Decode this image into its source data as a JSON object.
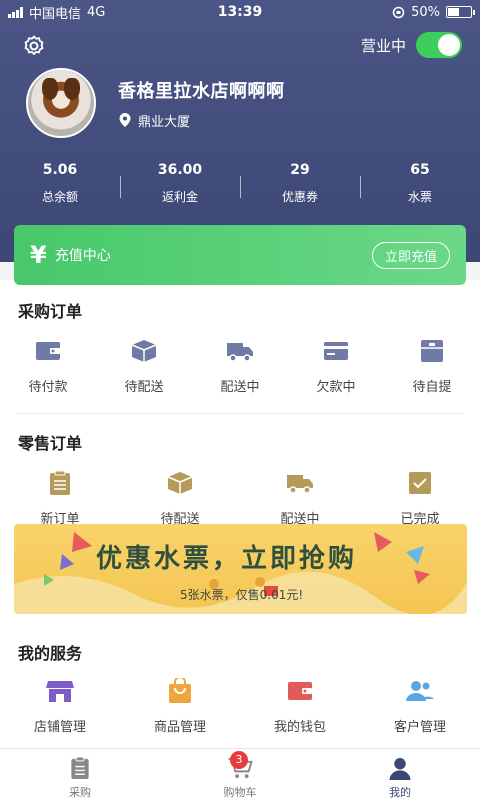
{
  "status_bar": {
    "carrier": "中国电信",
    "network": "4G",
    "time": "13:39",
    "battery": "50%",
    "battery_level": 0.5
  },
  "header": {
    "open_label": "营业中",
    "open_state": true
  },
  "shop": {
    "name": "香格里拉水店啊啊啊",
    "location": "鼎业大厦"
  },
  "stats": [
    {
      "value": "5.06",
      "label": "总余额"
    },
    {
      "value": "36.00",
      "label": "返利金"
    },
    {
      "value": "29",
      "label": "优惠券"
    },
    {
      "value": "65",
      "label": "水票"
    }
  ],
  "recharge": {
    "symbol": "¥",
    "title": "充值中心",
    "button": "立即充值"
  },
  "purchase_orders": {
    "title": "采购订单",
    "items": [
      {
        "label": "待付款",
        "icon": "wallet-icon"
      },
      {
        "label": "待配送",
        "icon": "box-icon"
      },
      {
        "label": "配送中",
        "icon": "truck-icon"
      },
      {
        "label": "欠款中",
        "icon": "card-icon"
      },
      {
        "label": "待自提",
        "icon": "package-icon"
      }
    ]
  },
  "retail_orders": {
    "title": "零售订单",
    "items": [
      {
        "label": "新订单",
        "icon": "clipboard-icon"
      },
      {
        "label": "待配送",
        "icon": "box-icon"
      },
      {
        "label": "配送中",
        "icon": "truck-icon"
      },
      {
        "label": "已完成",
        "icon": "check-icon"
      }
    ]
  },
  "banner": {
    "title": "优惠水票，立即抢购",
    "subtitle": "5张水票，仅售0.01元!"
  },
  "services": {
    "title": "我的服务",
    "items": [
      {
        "label": "店铺管理",
        "icon": "store-icon"
      },
      {
        "label": "商品管理",
        "icon": "bag-icon"
      },
      {
        "label": "我的钱包",
        "icon": "wallet-icon"
      },
      {
        "label": "客户管理",
        "icon": "users-icon"
      }
    ]
  },
  "tabbar": {
    "items": [
      {
        "label": "采购",
        "icon": "clipboard-icon"
      },
      {
        "label": "购物车",
        "icon": "cart-icon",
        "badge": "3"
      },
      {
        "label": "我的",
        "icon": "person-icon"
      }
    ]
  },
  "colors": {
    "header": "#3d4775",
    "accent_green": "#47c86a",
    "purchase_icon": "#6f7aa6",
    "retail_icon": "#b59a5a",
    "badge": "#e83b3b"
  }
}
